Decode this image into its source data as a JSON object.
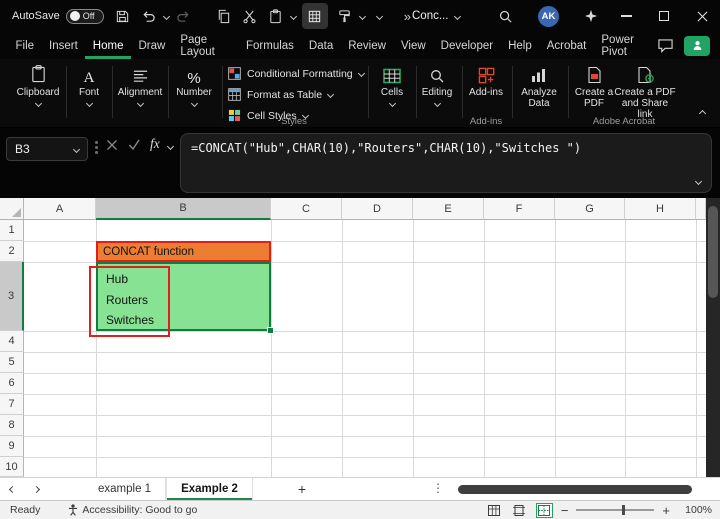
{
  "titlebar": {
    "autosave_label": "AutoSave",
    "autosave_state": "Off",
    "doc_title": "Conc...",
    "avatar_initials": "AK"
  },
  "menubar": {
    "items": [
      "File",
      "Insert",
      "Home",
      "Draw",
      "Page Layout",
      "Formulas",
      "Data",
      "Review",
      "View",
      "Developer",
      "Help",
      "Acrobat",
      "Power Pivot"
    ],
    "active": "Home"
  },
  "ribbon": {
    "clipboard_label": "Clipboard",
    "font_label": "Font",
    "alignment_label": "Alignment",
    "number_label": "Number",
    "conditional_formatting_label": "Conditional Formatting",
    "format_as_table_label": "Format as Table",
    "cell_styles_label": "Cell Styles",
    "styles_group_label": "Styles",
    "cells_label": "Cells",
    "editing_label": "Editing",
    "addins_button_label": "Add-ins",
    "addins_group_label": "Add-ins",
    "analyze_data_label": "Analyze Data",
    "create_pdf_label": "Create a PDF",
    "create_pdf_share_label": "Create a PDF and Share link",
    "acrobat_group_label": "Adobe Acrobat"
  },
  "formula_bar": {
    "name_box": "B3",
    "fx": "fx",
    "formula": "=CONCAT(\"Hub\",CHAR(10),\"Routers\",CHAR(10),\"Switches \")"
  },
  "grid": {
    "columns": [
      "A",
      "B",
      "C",
      "D",
      "E",
      "F",
      "G",
      "H"
    ],
    "rows": [
      "1",
      "2",
      "3",
      "4",
      "5",
      "6",
      "7",
      "8",
      "9",
      "10"
    ],
    "selected_cell": "B3",
    "b2_text": "CONCAT function",
    "b3_line1": "Hub",
    "b3_line2": "Routers",
    "b3_line3": "Switches"
  },
  "sheet_tabs": {
    "tab1": "example 1",
    "tab2": "Example 2",
    "active": "Example 2"
  },
  "status_bar": {
    "ready": "Ready",
    "accessibility": "Accessibility: Good to go",
    "zoom": "100%"
  },
  "theme": {
    "accent_green": "#21A366",
    "selection_green": "#107C41",
    "annotation_red": "#E11D1D",
    "b2_fill": "#ED7D31",
    "b3_fill": "#87E293",
    "titlebar_bg": "#060606",
    "avatar_blue": "#3B66B0"
  }
}
